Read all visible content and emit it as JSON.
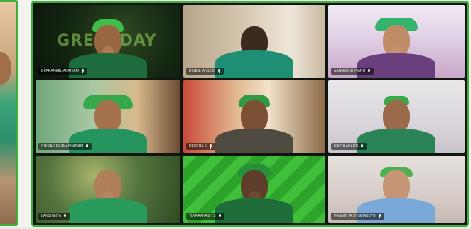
{
  "background_text": {
    "wall_sign": "GREENDAY"
  },
  "participants": [
    {
      "name": "DI PRANEEL ABRIYAM"
    },
    {
      "name": "DINESHA SUNS"
    },
    {
      "name": "AANGNA SHIVANIJ"
    },
    {
      "name": "CHIRAG PRAKASHANAM"
    },
    {
      "name": "DEEKHA S"
    },
    {
      "name": "NIKITA ANAND"
    },
    {
      "name": "LAKSHMITA"
    },
    {
      "name": "TIA PRAKASH S"
    },
    {
      "name": "PRANITHA SHISHAKUYB"
    }
  ],
  "colors": {
    "accent_border": "#3fae3a",
    "tile_bg": "#101510"
  },
  "icons": [
    "mic-icon"
  ]
}
